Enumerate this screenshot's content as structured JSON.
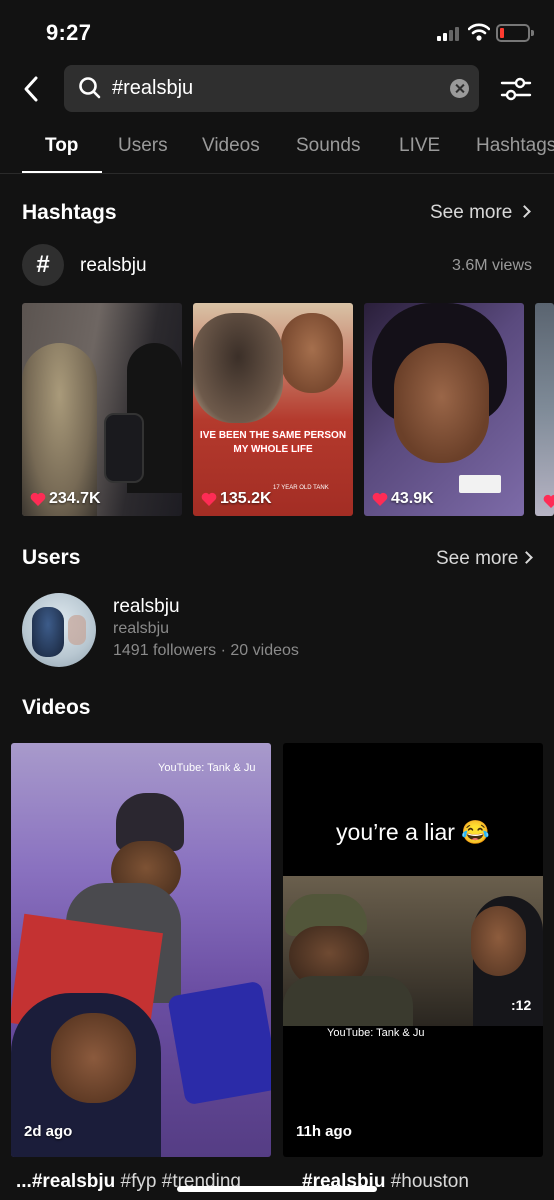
{
  "status_bar": {
    "time": "9:27"
  },
  "search": {
    "query": "#realsbju"
  },
  "tabs": [
    {
      "label": "Top",
      "active": true
    },
    {
      "label": "Users",
      "active": false
    },
    {
      "label": "Videos",
      "active": false
    },
    {
      "label": "Sounds",
      "active": false
    },
    {
      "label": "LIVE",
      "active": false
    },
    {
      "label": "Hashtags",
      "active": false
    }
  ],
  "hashtags_section": {
    "title": "Hashtags",
    "see_more": "See more",
    "hashtag": {
      "symbol": "#",
      "name": "realsbju",
      "views": "3.6M views"
    },
    "thumbnails": [
      {
        "likes": "234.7K"
      },
      {
        "likes": "135.2K",
        "overlay_text": "IVE BEEN THE SAME PERSON MY WHOLE LIFE",
        "small_caption": "17 YEAR OLD TANK"
      },
      {
        "likes": "43.9K"
      },
      {
        "likes": ""
      }
    ]
  },
  "users_section": {
    "title": "Users",
    "see_more": "See more",
    "user": {
      "name": "realsbju",
      "handle": "realsbju",
      "meta": "1491 followers · 20 videos"
    }
  },
  "videos_section": {
    "title": "Videos",
    "items": [
      {
        "age": "2d ago",
        "watermark": "YouTube: Tank & Ju",
        "caption_tag": "...#realsbju",
        "caption_rest": " #fyp #trending"
      },
      {
        "age": "11h ago",
        "watermark": "YouTube: Tank & Ju",
        "title_text": "you’re a liar 😂",
        "timer": ":12",
        "caption_tag": "#realsbju",
        "caption_rest": " #houston"
      }
    ]
  },
  "colors": {
    "background": "#121212",
    "heart": "#fe2c55",
    "search_bg": "#2f2f2f"
  }
}
